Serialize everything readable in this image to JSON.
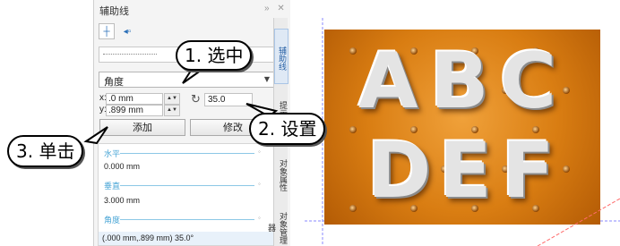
{
  "panel": {
    "title": "辅助线",
    "controls": "» ✕",
    "dropdown": {
      "value": "角度"
    },
    "x_label": "x:",
    "x_value": ".0 mm",
    "y_label": "y:",
    "y_value": ".899 mm",
    "angle_value": "35.0",
    "add_button": "添加",
    "modify_button": "修改",
    "list": {
      "horizontal_label": "水平",
      "horizontal_value": "0.000 mm",
      "vertical_label": "垂直",
      "vertical_value": "3.000 mm",
      "angle_label": "角度",
      "angle_value": "(.000 mm,.899 mm) 35.0°"
    }
  },
  "vtabs": [
    "辅助线",
    "提示",
    "对象属性",
    "对象管理器"
  ],
  "callouts": {
    "step1": "1. 选中",
    "step2": "2. 设置",
    "step3": "3. 单击"
  },
  "canvas": {
    "row1": [
      "A",
      "B",
      "C"
    ],
    "row2": [
      "D",
      "E",
      "F"
    ],
    "accent": "#d97d12",
    "guide_color": "#8a8aff"
  }
}
